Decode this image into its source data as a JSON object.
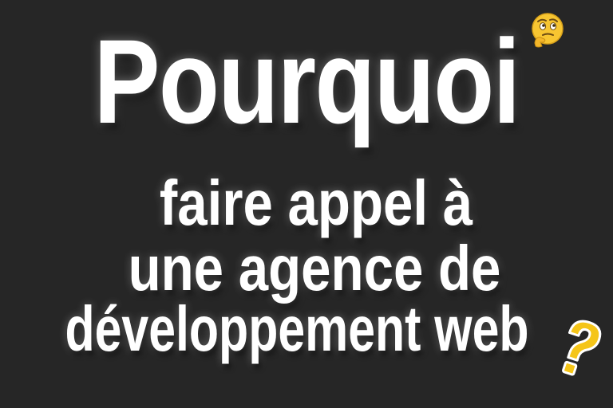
{
  "headline": "Pourquoi",
  "lines": [
    "faire appel à",
    "une agence de",
    "développement web"
  ],
  "icons": {
    "thinking": "thinking-face-emoji",
    "question": "question-mark"
  },
  "colors": {
    "background": "#262626",
    "text": "#ffffff",
    "emoji_face": "#f7c531",
    "question_mark": "#f5c518"
  }
}
